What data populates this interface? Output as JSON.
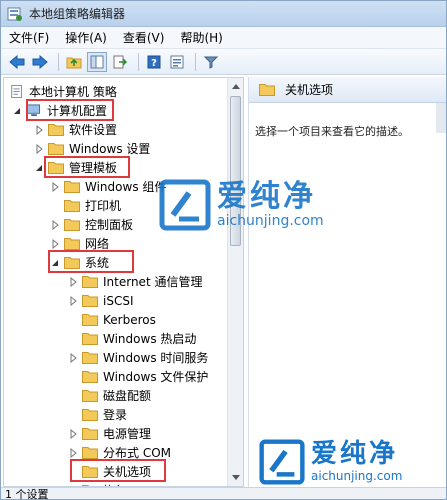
{
  "window": {
    "title": "本地组策略编辑器"
  },
  "menubar": {
    "items": [
      "文件(F)",
      "操作(A)",
      "查看(V)",
      "帮助(H)"
    ]
  },
  "toolbar": {
    "icons": [
      "back-arrow",
      "forward-arrow",
      "up-folder",
      "show-hide-tree",
      "export-list",
      "help",
      "properties",
      "filter"
    ]
  },
  "tree": {
    "root": "本地计算机 策略",
    "computer_config": "计算机配置",
    "software_settings": "软件设置",
    "windows_settings": "Windows 设置",
    "admin_templates": "管理模板",
    "windows_components": "Windows 组件",
    "printers": "打印机",
    "control_panel": "控制面板",
    "network": "网络",
    "system": "系统",
    "system_children": [
      "Internet 通信管理",
      "iSCSI",
      "Kerberos",
      "Windows 热启动",
      "Windows 时间服务",
      "Windows 文件保护",
      "磁盘配额",
      "登录",
      "电源管理",
      "分布式 COM",
      "关机选项",
      "恢复"
    ]
  },
  "right_pane": {
    "header": "关机选项",
    "description": "选择一个项目来查看它的描述。"
  },
  "statusbar": {
    "text": "1 个设置"
  },
  "watermark": {
    "chinese": "爱纯净",
    "url": "aichunjing.com"
  },
  "colors": {
    "highlight_box": "#e0383d",
    "folder": "#f3c95a",
    "watermark": "#1a76c9"
  }
}
